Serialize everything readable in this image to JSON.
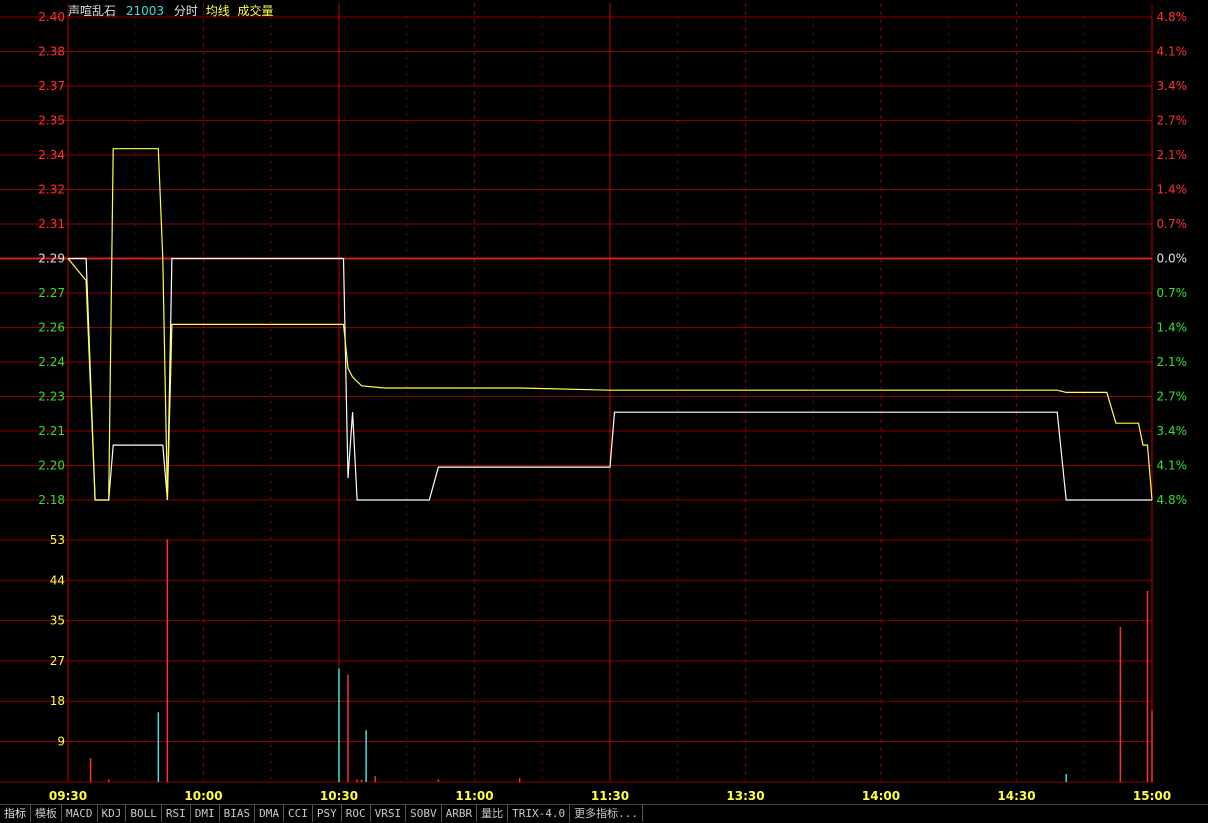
{
  "header": {
    "name": "声喧乱石",
    "code": "21003",
    "mode": "分时",
    "avg_label": "均线",
    "vol_label": "成交量"
  },
  "tabs": [
    "指标",
    "模板",
    "MACD",
    "KDJ",
    "BOLL",
    "RSI",
    "DMI",
    "BIAS",
    "DMA",
    "CCI",
    "PSY",
    "ROC",
    "VRSI",
    "SOBV",
    "ARBR",
    "量比",
    "TRIX-4.0",
    "更多指标..."
  ],
  "colors": {
    "background": "#000000",
    "grid": "#8b0000",
    "up": "#ff3030",
    "down": "#30e030",
    "flat": "#e0e0e0",
    "price_line": "#ffffff",
    "avg_line": "#ffff40",
    "volume_cyan": "#40e0e0",
    "axis_time": "#ffff40"
  },
  "chart_data": {
    "type": "line",
    "prev_close": 2.29,
    "price_ylim": [
      2.18,
      2.4
    ],
    "price_ticks_left": [
      "2.40",
      "2.38",
      "2.37",
      "2.35",
      "2.34",
      "2.32",
      "2.31",
      "2.29",
      "2.27",
      "2.26",
      "2.24",
      "2.23",
      "2.21",
      "2.20",
      "2.18"
    ],
    "price_ticks_right": [
      "4.8%",
      "4.1%",
      "3.4%",
      "2.7%",
      "2.1%",
      "1.4%",
      "0.7%",
      "0.0%",
      "0.7%",
      "1.4%",
      "2.1%",
      "2.7%",
      "3.4%",
      "4.1%",
      "4.8%"
    ],
    "volume_ticks": [
      "53",
      "44",
      "35",
      "27",
      "18",
      "9"
    ],
    "volume_ylim": [
      0,
      61
    ],
    "time_labels": [
      "09:30",
      "10:00",
      "10:30",
      "11:00",
      "11:30",
      "13:30",
      "14:00",
      "14:30",
      "15:00"
    ],
    "series": [
      {
        "name": "分时",
        "points": [
          [
            0,
            2.29
          ],
          [
            4,
            2.29
          ],
          [
            6,
            2.18
          ],
          [
            9,
            2.18
          ],
          [
            10,
            2.205
          ],
          [
            21,
            2.205
          ],
          [
            22,
            2.18
          ],
          [
            23,
            2.29
          ],
          [
            61,
            2.29
          ],
          [
            62,
            2.19
          ],
          [
            63,
            2.22
          ],
          [
            64,
            2.18
          ],
          [
            80,
            2.18
          ],
          [
            82,
            2.195
          ],
          [
            120,
            2.195
          ],
          [
            121,
            2.22
          ],
          [
            219,
            2.22
          ],
          [
            221,
            2.18
          ],
          [
            240,
            2.18
          ]
        ]
      },
      {
        "name": "均线",
        "points": [
          [
            0,
            2.29
          ],
          [
            4,
            2.28
          ],
          [
            6,
            2.18
          ],
          [
            9,
            2.18
          ],
          [
            10,
            2.34
          ],
          [
            20,
            2.34
          ],
          [
            21,
            2.29
          ],
          [
            22,
            2.18
          ],
          [
            23,
            2.26
          ],
          [
            61,
            2.26
          ],
          [
            62,
            2.24
          ],
          [
            63,
            2.236
          ],
          [
            65,
            2.232
          ],
          [
            70,
            2.231
          ],
          [
            100,
            2.231
          ],
          [
            120,
            2.23
          ],
          [
            200,
            2.23
          ],
          [
            219,
            2.23
          ],
          [
            221,
            2.229
          ],
          [
            230,
            2.229
          ],
          [
            232,
            2.215
          ],
          [
            237,
            2.215
          ],
          [
            238,
            2.205
          ],
          [
            239,
            2.205
          ],
          [
            240,
            2.18
          ]
        ]
      }
    ],
    "volume": [
      {
        "x": 5,
        "v": 6,
        "c": "up"
      },
      {
        "x": 9,
        "v": 0.6,
        "c": "up"
      },
      {
        "x": 20,
        "v": 17.5,
        "c": "cyan"
      },
      {
        "x": 22,
        "v": 61,
        "c": "up"
      },
      {
        "x": 60,
        "v": 28.5,
        "c": "cyan"
      },
      {
        "x": 62,
        "v": 27,
        "c": "up"
      },
      {
        "x": 64,
        "v": 0.6,
        "c": "up"
      },
      {
        "x": 65,
        "v": 0.6,
        "c": "up"
      },
      {
        "x": 66,
        "v": 13,
        "c": "cyan"
      },
      {
        "x": 68,
        "v": 1.5,
        "c": "up"
      },
      {
        "x": 82,
        "v": 0.6,
        "c": "up"
      },
      {
        "x": 100,
        "v": 1,
        "c": "up"
      },
      {
        "x": 221,
        "v": 2,
        "c": "cyan"
      },
      {
        "x": 233,
        "v": 39,
        "c": "up"
      },
      {
        "x": 239,
        "v": 48,
        "c": "up"
      },
      {
        "x": 240,
        "v": 18,
        "c": "up"
      }
    ]
  }
}
